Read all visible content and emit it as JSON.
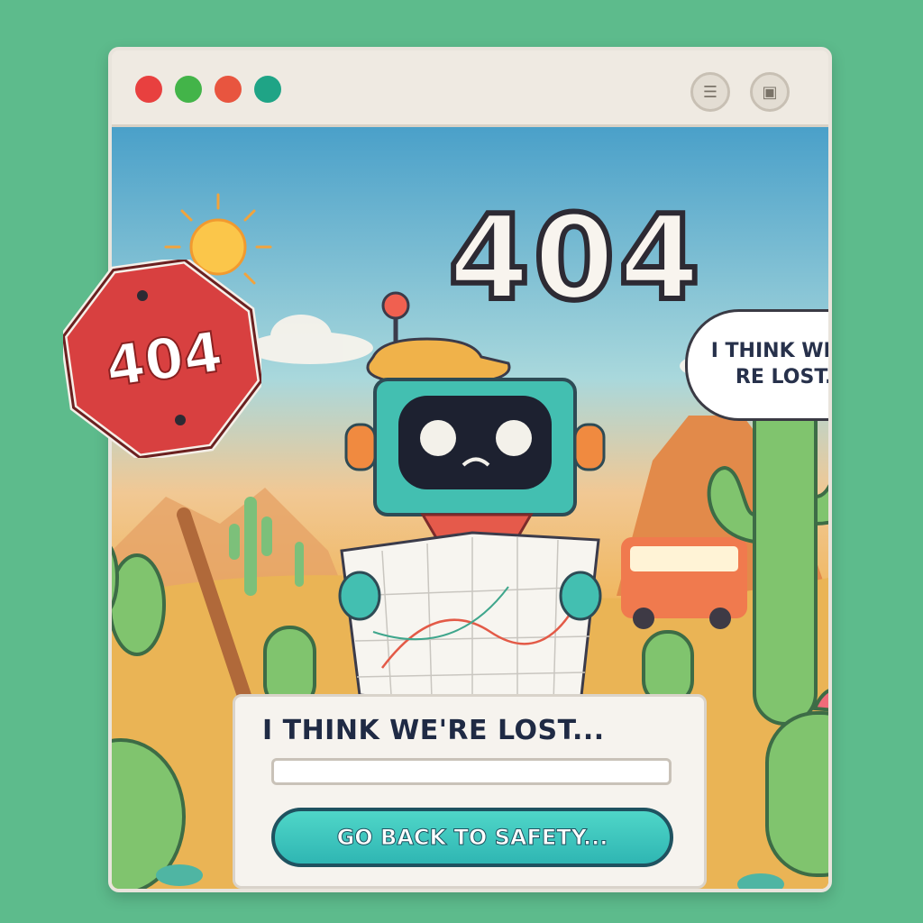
{
  "window": {
    "traffic_lights": [
      "#e8403f",
      "#43b449",
      "#e8553f",
      "#1fa486"
    ],
    "titlebar_buttons": [
      {
        "icon": "minimize-icon"
      },
      {
        "icon": "maximize-icon"
      }
    ]
  },
  "hero": {
    "title": "404",
    "sign_text": "404",
    "speech_bubble": "I THINK WE'RE\nRE LOST..."
  },
  "dialog": {
    "message": "I THINK WE'RE LOST...",
    "input_value": "",
    "button_label": "GO BACK TO SAFETY..."
  },
  "colors": {
    "background": "#5dbb8c",
    "accent": "#37c2b8",
    "sign_red": "#d84040"
  }
}
